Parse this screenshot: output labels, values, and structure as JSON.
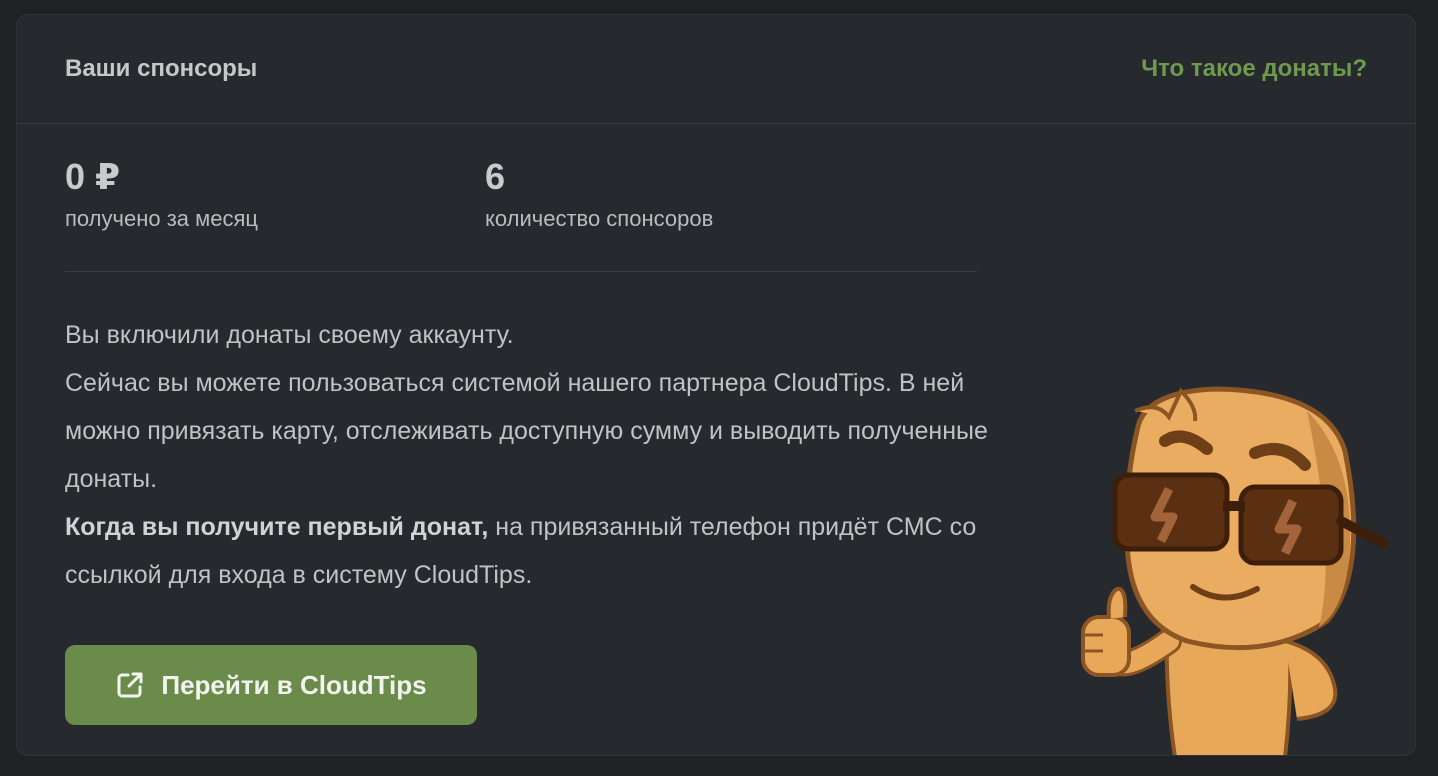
{
  "header": {
    "title": "Ваши спонсоры",
    "help_link": "Что такое донаты?"
  },
  "stats": [
    {
      "value": "0 ₽",
      "label": "получено за месяц"
    },
    {
      "value": "6",
      "label": "количество спонсоров"
    }
  ],
  "description": {
    "line1": "Вы включили донаты своему аккаунту.",
    "line2": "Сейчас вы можете пользоваться системой нашего партнера CloudTips. В ней можно привязать карту, отслеживать доступную сумму и выводить полученные донаты.",
    "bold": "Когда вы получите первый донат,",
    "rest": " на привязанный телефон придёт СМС со ссылкой для входа в систему CloudTips."
  },
  "cta": {
    "label": "Перейти в CloudTips",
    "icon": "external-link-icon"
  },
  "mascot": {
    "icon": "mascot-sunglasses-thumbs-up"
  },
  "colors": {
    "background": "#1f2124",
    "panel": "#26292e",
    "accent": "#6b8b4b",
    "link": "#6f9a4e"
  }
}
